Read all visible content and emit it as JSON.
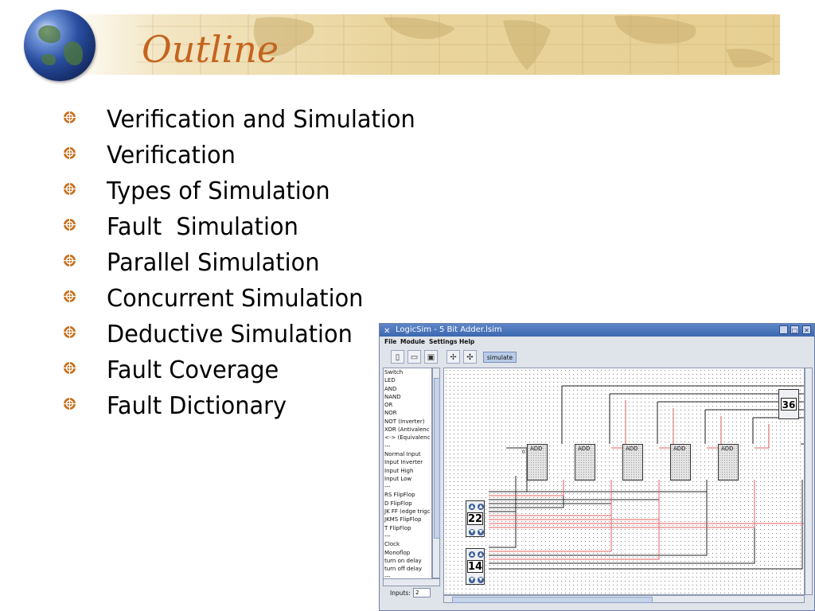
{
  "slide": {
    "title": "Outline",
    "bullets": [
      "Verification and Simulation",
      "Verification",
      "Types of Simulation",
      "Fault  Simulation",
      "Parallel Simulation",
      "Concurrent Simulation",
      "Deductive Simulation",
      "Fault Coverage",
      "Fault Dictionary"
    ],
    "accent_color": "#c4641e",
    "bullet_color": "#c8701e"
  },
  "logicsim": {
    "window_title": "LogicSim - 5 Bit Adder.lsim",
    "menu": [
      "File",
      "Module",
      "Settings",
      "Help"
    ],
    "toolbar": {
      "icons": [
        "new-file-icon",
        "open-folder-icon",
        "save-disk-icon",
        "wire-add-icon",
        "wire-remove-icon"
      ],
      "simulate_label": "simulate"
    },
    "palette_items": [
      "Switch",
      "LED",
      "AND",
      "NAND",
      "OR",
      "NOR",
      "NOT (Inverter)",
      "XOR (Antivalenc",
      "<-> (Equivalenc",
      "---",
      "Normal Input",
      "Input Inverter",
      "Input High",
      "Input Low",
      "---",
      "RS FlipFlop",
      "D FlipFlop",
      "JK FF (edge trigc",
      "JKMS FlipFlop",
      "T FlipFlop",
      "---",
      "Clock",
      "Monoflop",
      "turn on delay",
      "turn off delay",
      "---"
    ],
    "inputs_label": "Inputs:",
    "inputs_value": "2",
    "adders": [
      "ADD",
      "ADD",
      "ADD",
      "ADD",
      "ADD"
    ],
    "input_a": "22",
    "input_b": "14",
    "output": "36",
    "small_zero": "0"
  }
}
